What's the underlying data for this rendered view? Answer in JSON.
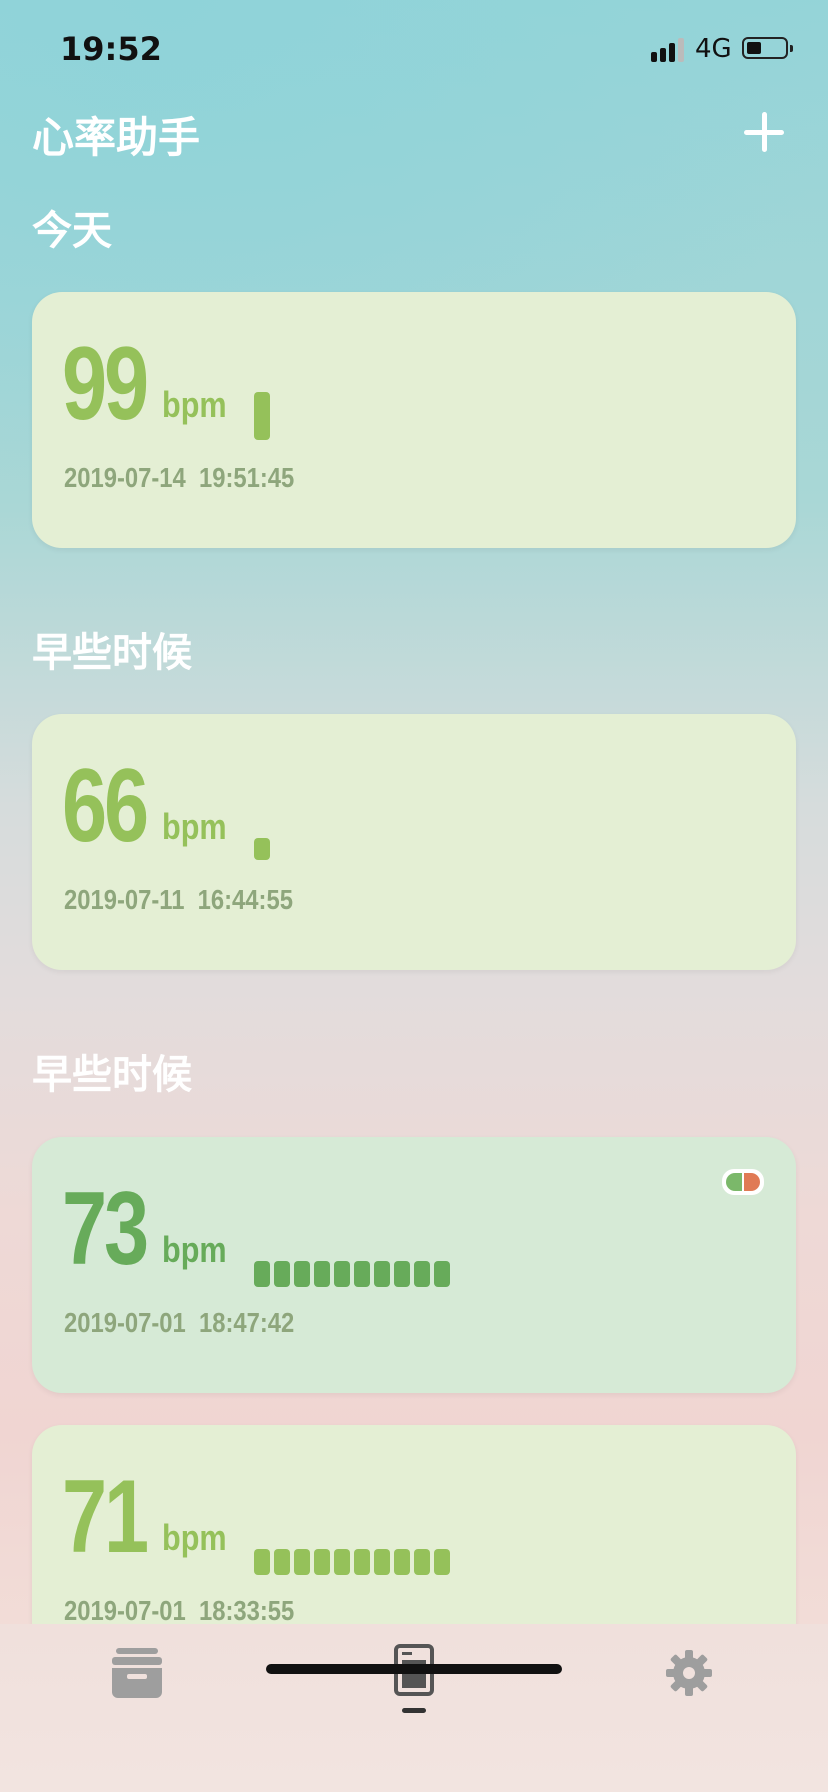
{
  "status_bar": {
    "time": "19:52",
    "network": "4G",
    "battery_level": 0.35
  },
  "header": {
    "title": "心率助手",
    "add_icon": "plus-icon"
  },
  "sections": [
    {
      "title": "今天"
    },
    {
      "title": "早些时候"
    },
    {
      "title": "早些时候"
    }
  ],
  "records": [
    {
      "bpm": "99",
      "unit": "bpm",
      "date": "2019-07-14  19:51:45",
      "bars": 1,
      "bar_style": "tall",
      "tone": "light"
    },
    {
      "bpm": "66",
      "unit": "bpm",
      "date": "2019-07-11  16:44:55",
      "bars": 1,
      "bar_style": "short",
      "tone": "light"
    },
    {
      "bpm": "73",
      "unit": "bpm",
      "date": "2019-07-01  18:47:42",
      "bars": 10,
      "bar_style": "short",
      "tone": "mid",
      "has_pill_icon": true
    },
    {
      "bpm": "71",
      "unit": "bpm",
      "date": "2019-07-01  18:33:55",
      "bars": 10,
      "bar_style": "short",
      "tone": "light"
    }
  ],
  "tab_bar": {
    "items": [
      {
        "icon": "archive-icon",
        "active": false
      },
      {
        "icon": "device-icon",
        "active": true
      },
      {
        "icon": "gear-icon",
        "active": false
      }
    ]
  },
  "colors": {
    "bpm_light": "#95c15a",
    "bpm_mid": "#67ab5a",
    "date": "#8ea67c",
    "card_light": "#e4efd4",
    "card_mid": "#d6ead6"
  }
}
